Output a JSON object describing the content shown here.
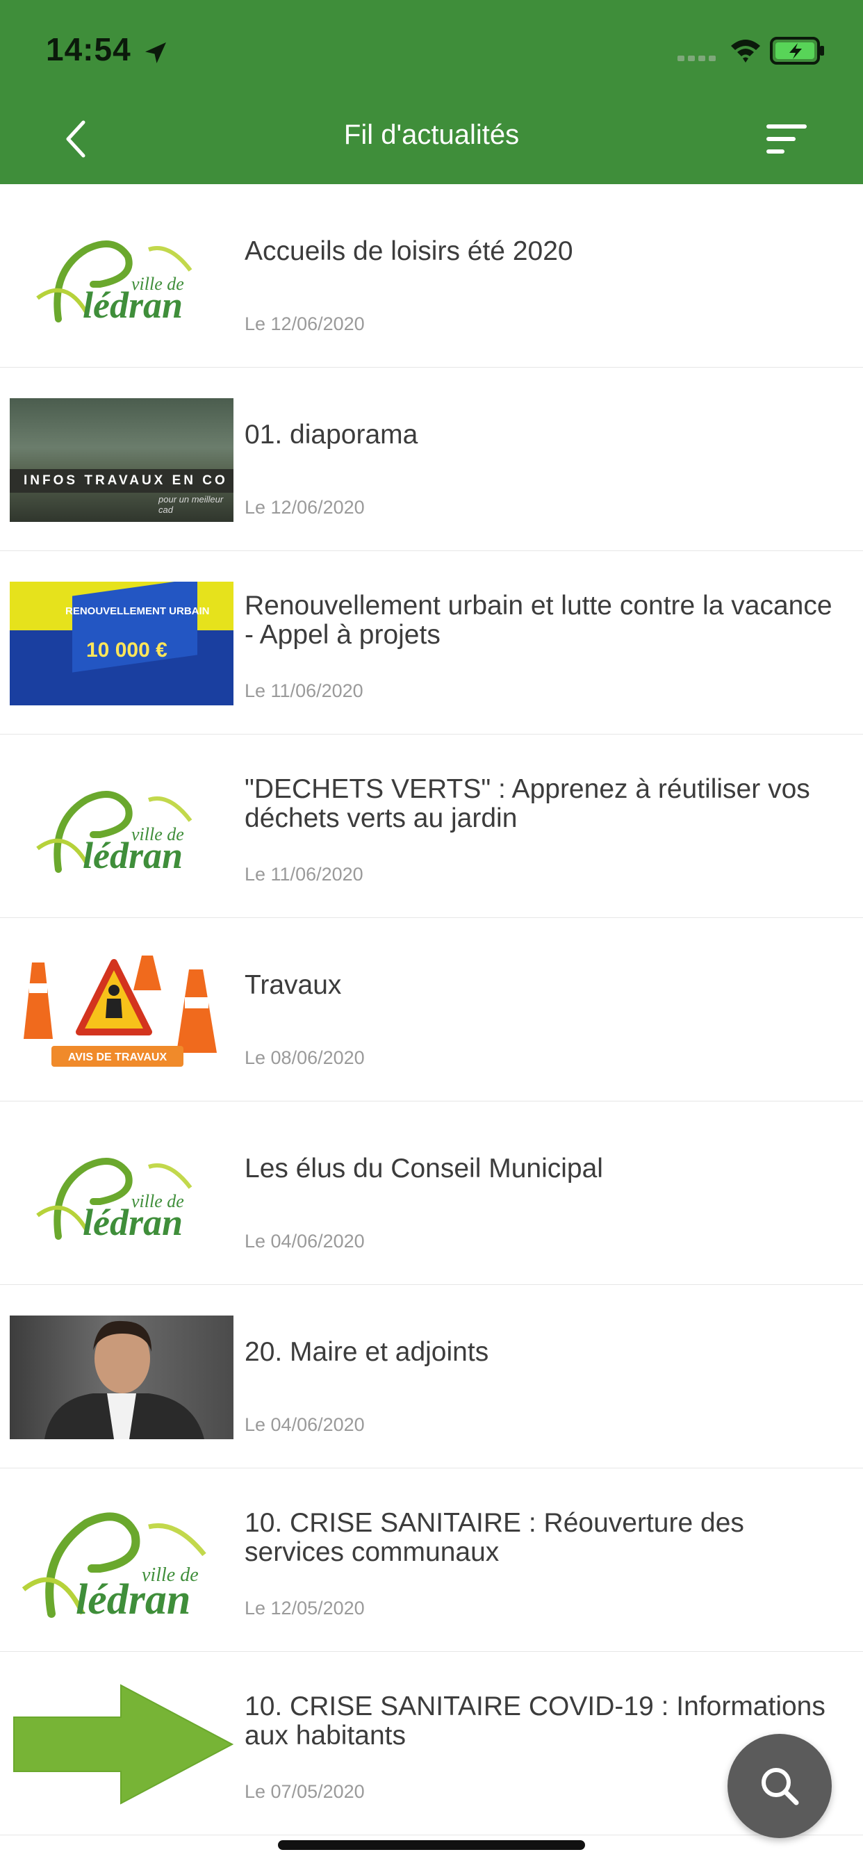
{
  "status_bar": {
    "time": "14:54",
    "icons": [
      "location-arrow-icon",
      "signal-icon",
      "wifi-icon",
      "battery-charging-icon"
    ]
  },
  "header": {
    "title": "Fil d'actualités",
    "back_icon": "chevron-left-icon",
    "filter_icon": "sort-lines-icon",
    "background_color": "#3f8e3a"
  },
  "news": [
    {
      "title": "Accueils de loisirs été 2020",
      "date": "Le 12/06/2020",
      "thumb": "logo"
    },
    {
      "title": "01. diaporama",
      "date": "Le 12/06/2020",
      "thumb": "works-photo",
      "thumb_text": "INFOS TRAVAUX EN CO",
      "thumb_subtext": "pour un meilleur cad"
    },
    {
      "title": "Renouvellement urbain et lutte contre la vacance - Appel à projets",
      "date": "Le 11/06/2020",
      "thumb": "poster",
      "thumb_text": "RENOUVELLEMENT URBAIN",
      "thumb_amount": "10 000 €"
    },
    {
      "title": "\"DECHETS VERTS\" : Apprenez à réutiliser vos déchets verts au jardin",
      "date": "Le 11/06/2020",
      "thumb": "logo"
    },
    {
      "title": "Travaux",
      "date": "Le 08/06/2020",
      "thumb": "cones",
      "thumb_text": "AVIS DE TRAVAUX"
    },
    {
      "title": "Les élus du Conseil Municipal",
      "date": "Le 04/06/2020",
      "thumb": "logo"
    },
    {
      "title": "20. Maire et adjoints",
      "date": "Le 04/06/2020",
      "thumb": "portrait"
    },
    {
      "title": "10. CRISE SANITAIRE : Réouverture des services communaux",
      "date": "Le 12/05/2020",
      "thumb": "logo"
    },
    {
      "title": "10. CRISE SANITAIRE COVID-19 : Informations aux habitants",
      "date": "Le 07/05/2020",
      "thumb": "arrow"
    }
  ],
  "logo": {
    "line1": "ville de",
    "line2": "lédran"
  },
  "fab": {
    "icon": "search-icon",
    "color": "#5b5b5b"
  }
}
